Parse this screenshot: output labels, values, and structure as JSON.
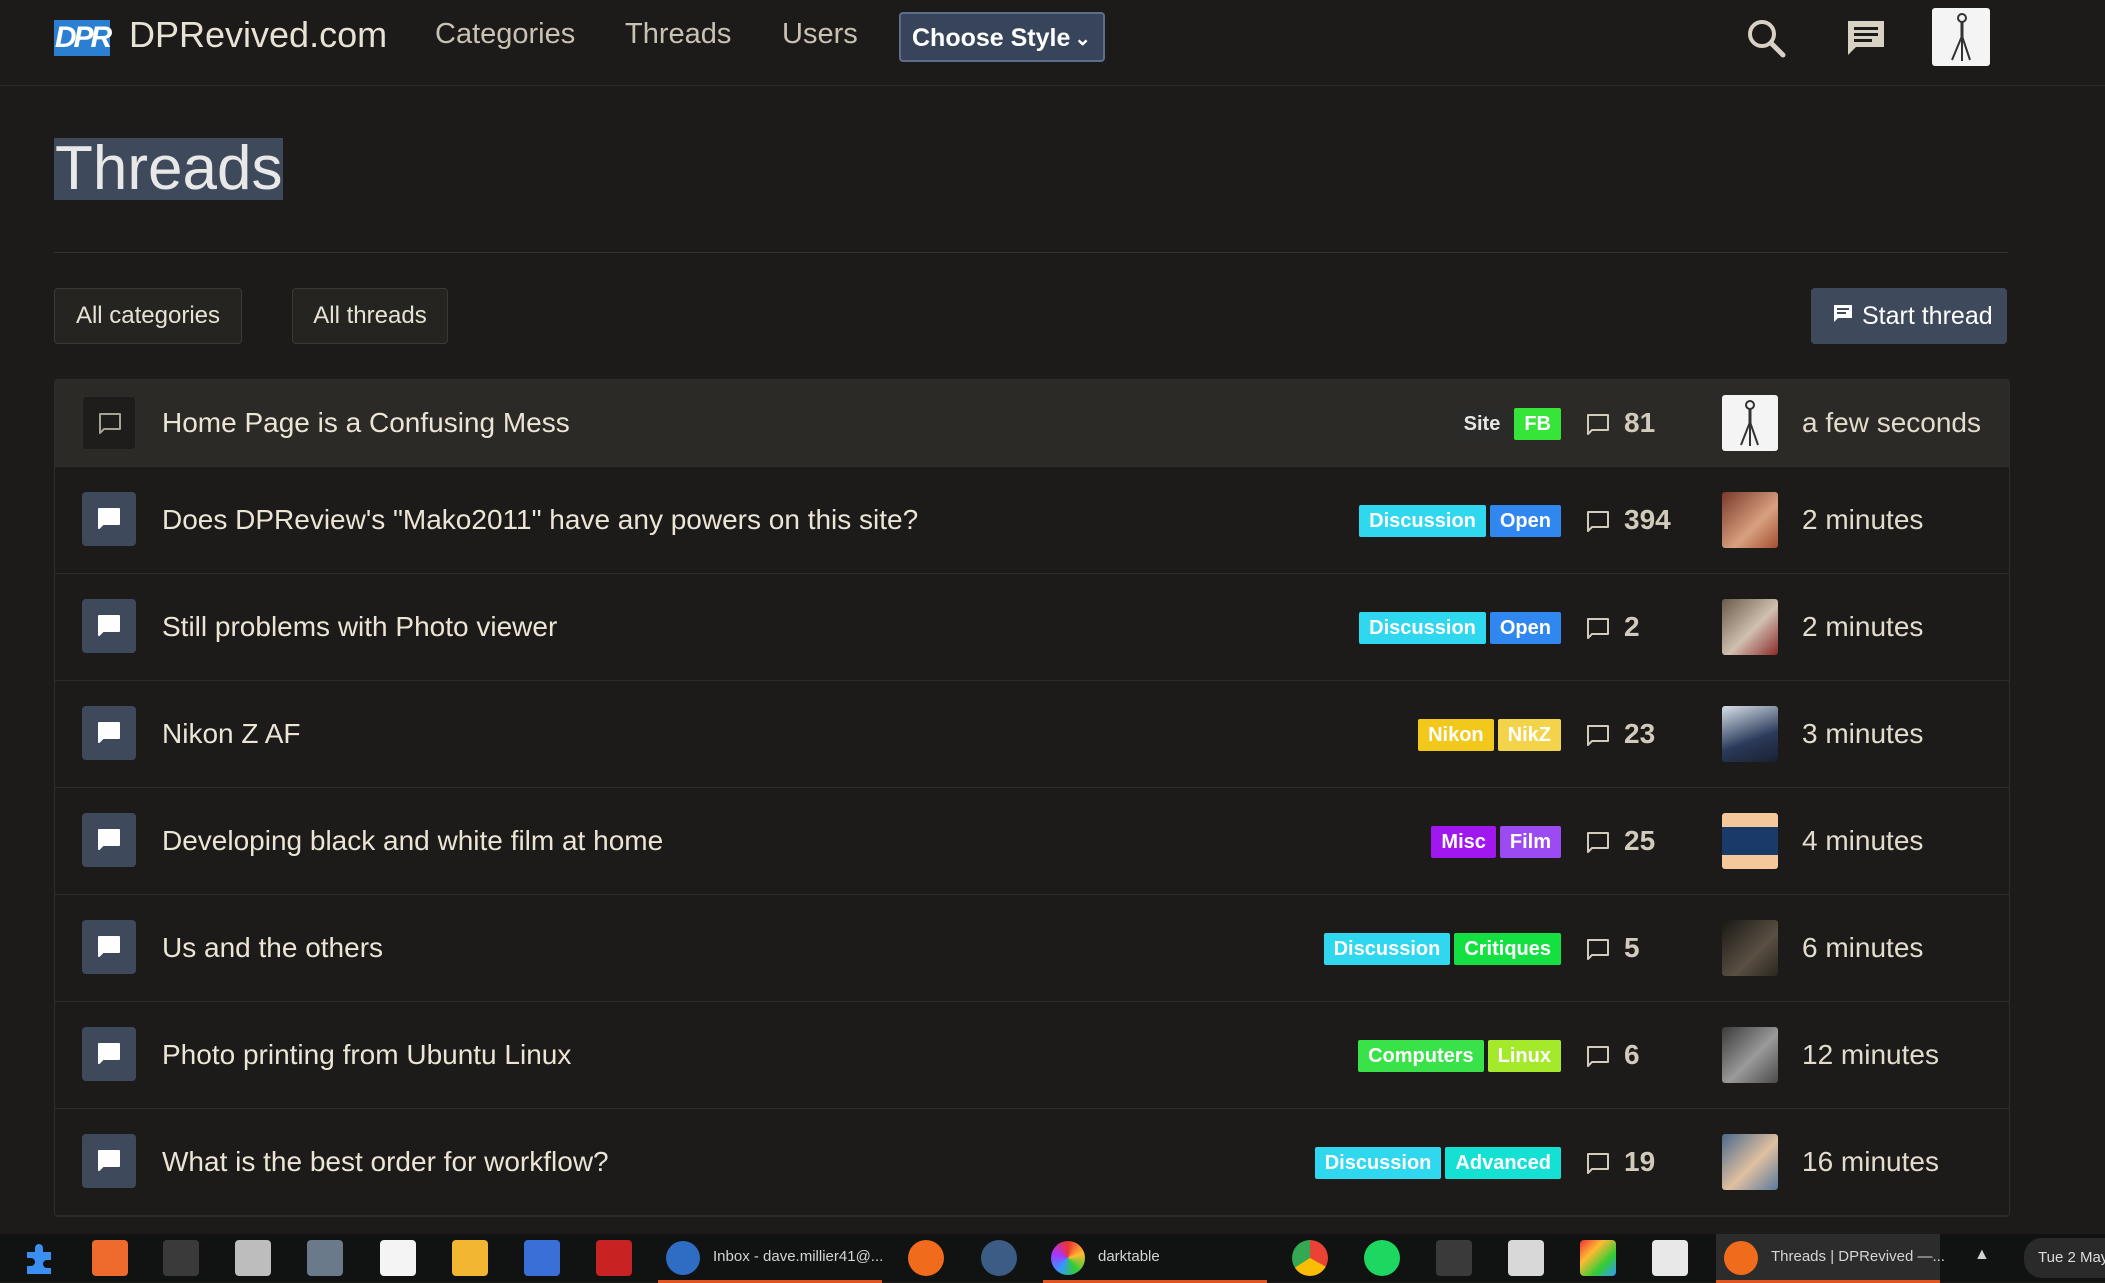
{
  "header": {
    "site_name": "DPRevived.com",
    "logo_text": "DPR",
    "nav": [
      "Categories",
      "Threads",
      "Users"
    ],
    "style_button": "Choose Style"
  },
  "page": {
    "title": "Threads",
    "filters": [
      "All categories",
      "All threads"
    ],
    "start_thread": "Start thread"
  },
  "threads": [
    {
      "title": "Home Page is a Confusing Mess",
      "tags": [
        {
          "label": "Site",
          "bg": "#2a2a28",
          "fg": "#e6e6e6"
        },
        {
          "label": "FB",
          "bg": "#37e53a",
          "fg": "#ffffff"
        }
      ],
      "replies": "81",
      "time": "a few seconds"
    },
    {
      "title": "Does DPReview's \"Mako2011\" have any powers on this site?",
      "tags": [
        {
          "label": "Discussion",
          "bg": "#2fd7ef",
          "fg": "#ffffff"
        },
        {
          "label": "Open",
          "bg": "#2f87ef",
          "fg": "#ffffff"
        }
      ],
      "replies": "394",
      "time": "2 minutes"
    },
    {
      "title": "Still problems with Photo viewer",
      "tags": [
        {
          "label": "Discussion",
          "bg": "#2fd7ef",
          "fg": "#ffffff"
        },
        {
          "label": "Open",
          "bg": "#2f87ef",
          "fg": "#ffffff"
        }
      ],
      "replies": "2",
      "time": "2 minutes"
    },
    {
      "title": "Nikon Z AF",
      "tags": [
        {
          "label": "Nikon",
          "bg": "#f2c81a",
          "fg": "#ffffff"
        },
        {
          "label": "NikZ",
          "bg": "#f2d34a",
          "fg": "#ffffff"
        }
      ],
      "replies": "23",
      "time": "3 minutes"
    },
    {
      "title": "Developing black and white film at home",
      "tags": [
        {
          "label": "Misc",
          "bg": "#a117ef",
          "fg": "#ffffff"
        },
        {
          "label": "Film",
          "bg": "#9c4bf2",
          "fg": "#ffffff"
        }
      ],
      "replies": "25",
      "time": "4 minutes"
    },
    {
      "title": "Us and the others",
      "tags": [
        {
          "label": "Discussion",
          "bg": "#2fd7ef",
          "fg": "#ffffff"
        },
        {
          "label": "Critiques",
          "bg": "#15e041",
          "fg": "#ffffff"
        }
      ],
      "replies": "5",
      "time": "6 minutes"
    },
    {
      "title": "Photo printing from Ubuntu Linux",
      "tags": [
        {
          "label": "Computers",
          "bg": "#3ae24a",
          "fg": "#ffffff"
        },
        {
          "label": "Linux",
          "bg": "#a4e92a",
          "fg": "#ffffff"
        }
      ],
      "replies": "6",
      "time": "12 minutes"
    },
    {
      "title": "What is the best order for workflow?",
      "tags": [
        {
          "label": "Discussion",
          "bg": "#2fd7ef",
          "fg": "#ffffff"
        },
        {
          "label": "Advanced",
          "bg": "#15e0d4",
          "fg": "#ffffff"
        }
      ],
      "replies": "19",
      "time": "16 minutes"
    }
  ],
  "taskbar": {
    "thunderbird_label": "Inbox - dave.millier41@...",
    "darktable_label": "darktable",
    "firefox_label": "Threads | DPRevived —...",
    "clock": "Tue 2 May"
  },
  "colors": {
    "background": "#1c1b19",
    "accent": "#3e4a5c",
    "text": "#e8e2d4"
  }
}
